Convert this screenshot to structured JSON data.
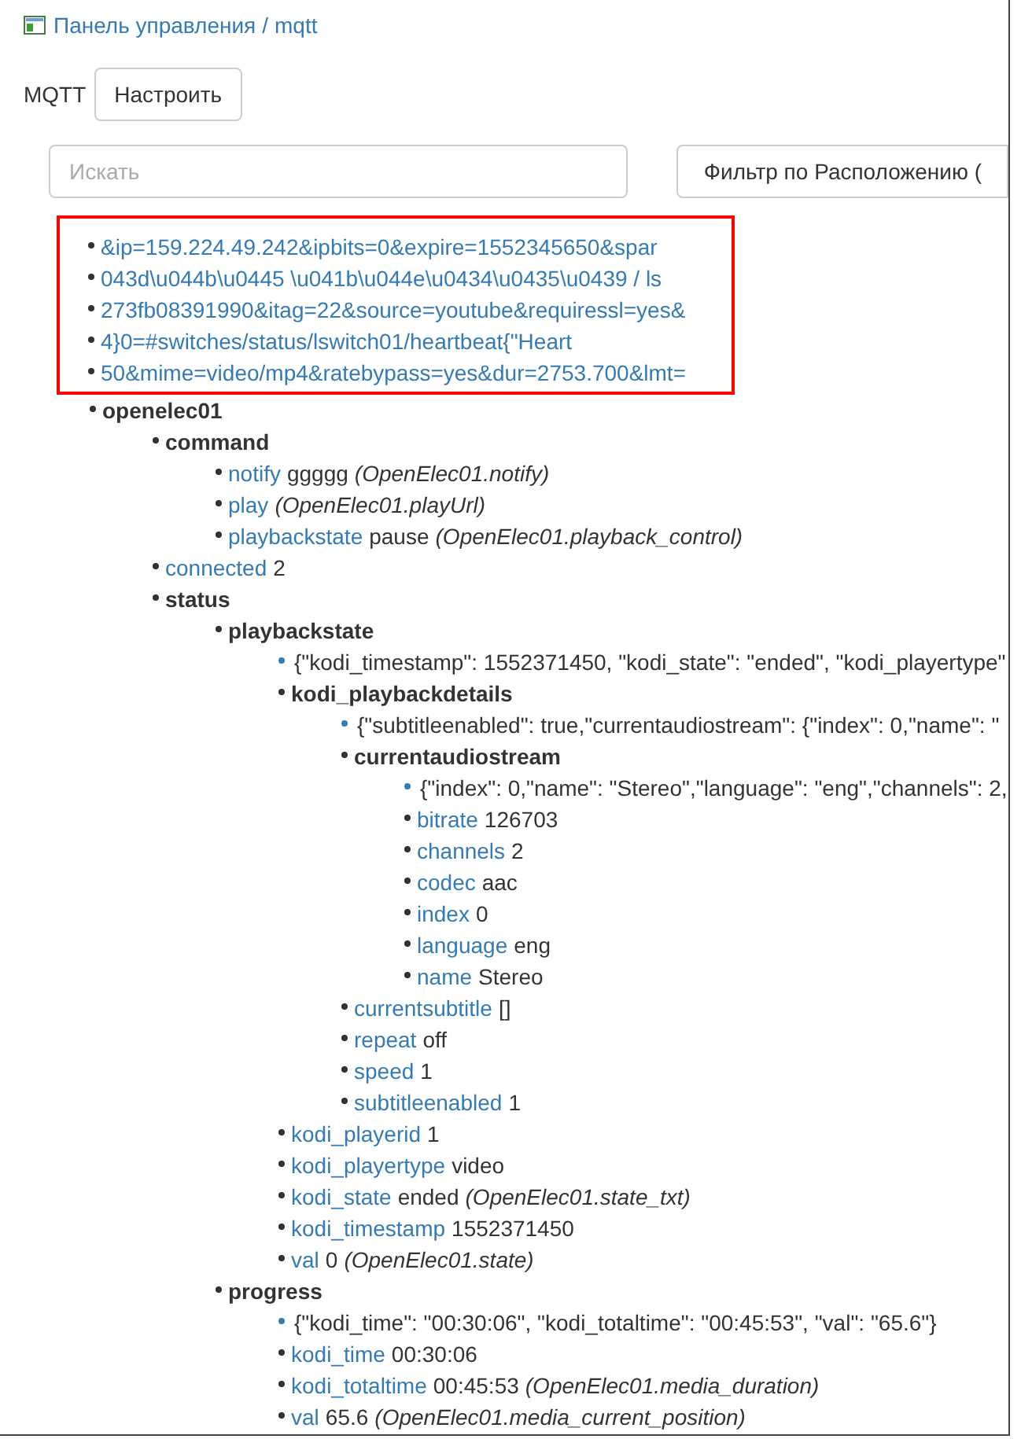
{
  "breadcrumb": {
    "root": "Панель управления",
    "separator": "/",
    "current": "mqtt"
  },
  "header": {
    "label": "MQTT",
    "button": "Настроить"
  },
  "search": {
    "placeholder": "Искать"
  },
  "filter_button": "Фильтр по Расположению (",
  "highlighted_lines": [
    "&ip=159.224.49.242&ipbits=0&expire=1552345650&spar",
    "043d\\u044b\\u0445 \\u041b\\u044e\\u0434\\u0435\\u0439 / ls",
    "273fb08391990&itag=22&source=youtube&requiressl=yes&",
    "4}0=#switches/status/lswitch01/heartbeat{\"Heart",
    "50&mime=video/mp4&ratebypass=yes&dur=2753.700&lmt="
  ],
  "tree": [
    {
      "kind": "group",
      "title": "openelec01",
      "children": [
        {
          "kind": "group",
          "title": "command",
          "children": [
            {
              "kind": "leaf",
              "key": "notify",
              "value": "ggggg",
              "binding": "(OpenElec01.notify)"
            },
            {
              "kind": "leaf",
              "key": "play",
              "binding": "(OpenElec01.playUrl)"
            },
            {
              "kind": "leaf",
              "key": "playbackstate",
              "value": "pause",
              "binding": "(OpenElec01.playback_control)"
            }
          ]
        },
        {
          "kind": "leaf",
          "key": "connected",
          "value": "2"
        },
        {
          "kind": "group",
          "title": "status",
          "children": [
            {
              "kind": "group",
              "title": "playbackstate",
              "children": [
                {
                  "kind": "raw",
                  "text": "{\"kodi_timestamp\": 1552371450, \"kodi_state\": \"ended\", \"kodi_playertype\""
                },
                {
                  "kind": "group",
                  "title": "kodi_playbackdetails",
                  "children": [
                    {
                      "kind": "raw",
                      "text": "{\"subtitleenabled\": true,\"currentaudiostream\": {\"index\": 0,\"name\": \""
                    },
                    {
                      "kind": "group",
                      "title": "currentaudiostream",
                      "children": [
                        {
                          "kind": "raw",
                          "text": "{\"index\": 0,\"name\": \"Stereo\",\"language\": \"eng\",\"channels\": 2,"
                        },
                        {
                          "kind": "leaf",
                          "key": "bitrate",
                          "value": "126703"
                        },
                        {
                          "kind": "leaf",
                          "key": "channels",
                          "value": "2"
                        },
                        {
                          "kind": "leaf",
                          "key": "codec",
                          "value": "aac"
                        },
                        {
                          "kind": "leaf",
                          "key": "index",
                          "value": "0"
                        },
                        {
                          "kind": "leaf",
                          "key": "language",
                          "value": "eng"
                        },
                        {
                          "kind": "leaf",
                          "key": "name",
                          "value": "Stereo"
                        }
                      ]
                    },
                    {
                      "kind": "leaf",
                      "key": "currentsubtitle",
                      "value": "[]"
                    },
                    {
                      "kind": "leaf",
                      "key": "repeat",
                      "value": "off"
                    },
                    {
                      "kind": "leaf",
                      "key": "speed",
                      "value": "1"
                    },
                    {
                      "kind": "leaf",
                      "key": "subtitleenabled",
                      "value": "1"
                    }
                  ]
                },
                {
                  "kind": "leaf",
                  "key": "kodi_playerid",
                  "value": "1"
                },
                {
                  "kind": "leaf",
                  "key": "kodi_playertype",
                  "value": "video"
                },
                {
                  "kind": "leaf",
                  "key": "kodi_state",
                  "value": "ended",
                  "binding": "(OpenElec01.state_txt)"
                },
                {
                  "kind": "leaf",
                  "key": "kodi_timestamp",
                  "value": "1552371450"
                },
                {
                  "kind": "leaf",
                  "key": "val",
                  "value": "0",
                  "binding": "(OpenElec01.state)"
                }
              ]
            },
            {
              "kind": "group",
              "title": "progress",
              "children": [
                {
                  "kind": "raw",
                  "text": "{\"kodi_time\": \"00:30:06\", \"kodi_totaltime\": \"00:45:53\", \"val\": \"65.6\"}"
                },
                {
                  "kind": "leaf",
                  "key": "kodi_time",
                  "value": "00:30:06"
                },
                {
                  "kind": "leaf",
                  "key": "kodi_totaltime",
                  "value": "00:45:53",
                  "binding": "(OpenElec01.media_duration)"
                },
                {
                  "kind": "leaf",
                  "key": "val",
                  "value": "65.6",
                  "binding": "(OpenElec01.media_current_position)"
                }
              ]
            }
          ]
        }
      ]
    }
  ]
}
